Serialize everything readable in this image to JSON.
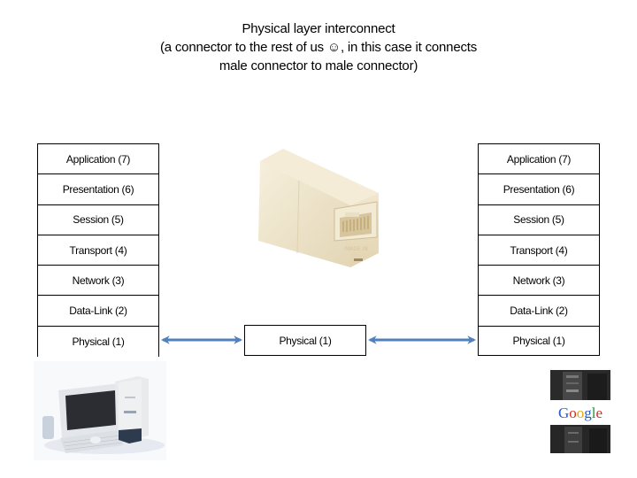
{
  "title": {
    "line1": "Physical layer interconnect",
    "line2": "(a connector to the rest of us ☺, in this case it connects",
    "line3": "male connector to male connector)"
  },
  "left_stack": {
    "layers": [
      {
        "label": "Application (7)"
      },
      {
        "label": "Presentation (6)"
      },
      {
        "label": "Session (5)"
      },
      {
        "label": "Transport (4)"
      },
      {
        "label": "Network (3)"
      },
      {
        "label": "Data-Link (2)"
      },
      {
        "label": "Physical (1)"
      }
    ]
  },
  "center": {
    "label": "Physical (1)"
  },
  "right_stack": {
    "layers": [
      {
        "label": "Application (7)"
      },
      {
        "label": "Presentation (6)"
      },
      {
        "label": "Session (5)"
      },
      {
        "label": "Transport (4)"
      },
      {
        "label": "Network (3)"
      },
      {
        "label": "Data-Link (2)"
      },
      {
        "label": "Physical (1)"
      }
    ]
  },
  "images": {
    "connector": "rj45-coupler-image",
    "computer": "desktop-computer-image",
    "google": "google-servers-image",
    "google_logo_text": "Google"
  },
  "colors": {
    "arrow": "#4F81BD",
    "connector_body": "#F0E6CE",
    "border": "#000000"
  }
}
